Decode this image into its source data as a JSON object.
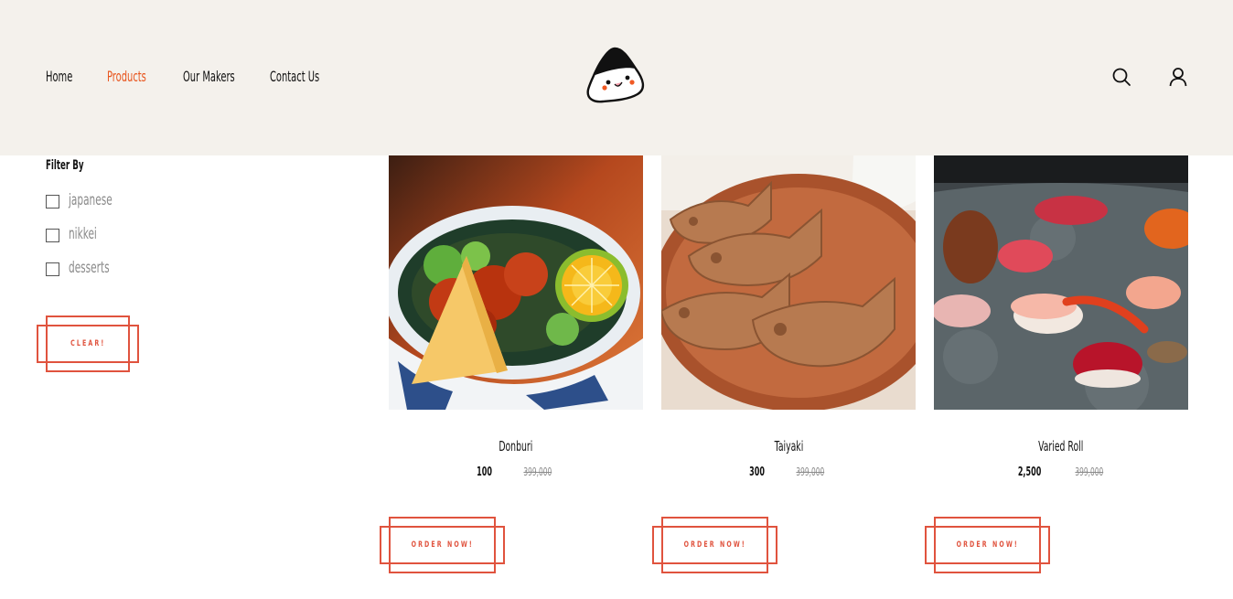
{
  "nav": {
    "items": [
      {
        "label": "Home",
        "active": false
      },
      {
        "label": "Products",
        "active": true
      },
      {
        "label": "Our Makers",
        "active": false
      },
      {
        "label": "Contact Us",
        "active": false
      }
    ]
  },
  "header": {
    "logo_icon": "onigiri-logo-icon",
    "search_icon": "search-icon",
    "account_icon": "user-icon"
  },
  "filter": {
    "title": "Filter By",
    "options": [
      {
        "label": "japanese",
        "checked": false
      },
      {
        "label": "nikkei",
        "checked": false
      },
      {
        "label": "desserts",
        "checked": false
      }
    ],
    "clear_label": "CLEAR!"
  },
  "products": [
    {
      "name": "Donburi",
      "price": "100",
      "old_price": "399,000",
      "order_label": "ORDER NOW!"
    },
    {
      "name": "Taiyaki",
      "price": "300",
      "old_price": "399,000",
      "order_label": "ORDER NOW!"
    },
    {
      "name": "Varied Roll",
      "price": "2,500",
      "old_price": "399,000",
      "order_label": "ORDER NOW!"
    }
  ],
  "colors": {
    "accent": "#e8541c",
    "button_outline": "#e0533e",
    "header_bg": "#f4f1ec",
    "muted_text": "#8a8a8a"
  }
}
